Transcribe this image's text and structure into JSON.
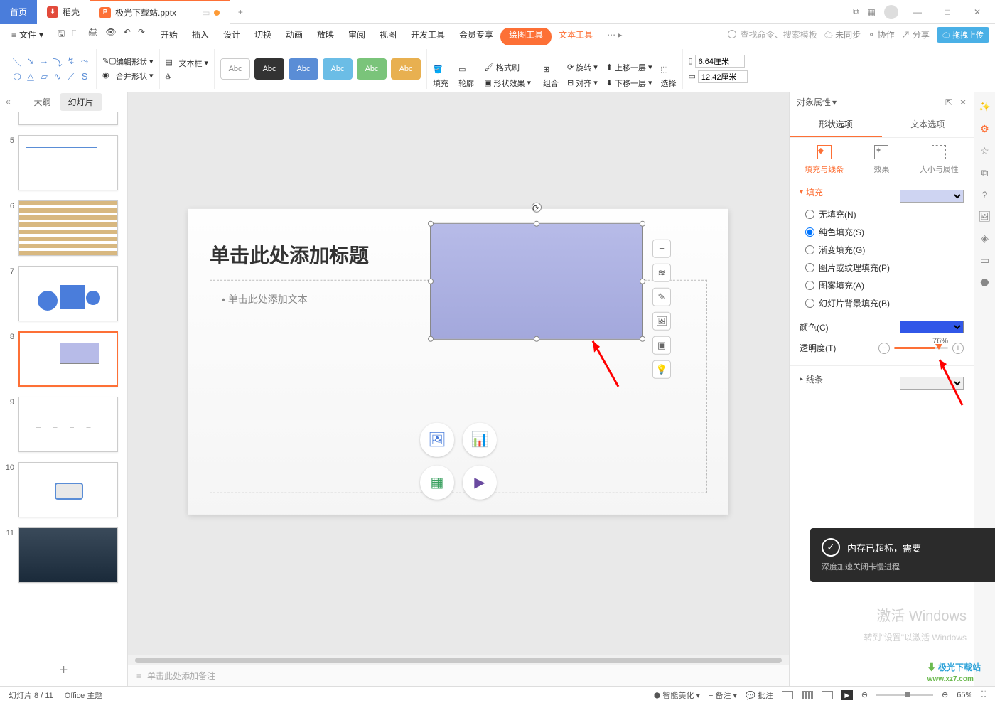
{
  "titlebar": {
    "home": "首页",
    "docer": "稻壳",
    "filename": "极光下载站.pptx"
  },
  "menubar": {
    "file": "文件",
    "menus": [
      "开始",
      "插入",
      "设计",
      "切换",
      "动画",
      "放映",
      "审阅",
      "视图",
      "开发工具",
      "会员专享"
    ],
    "contextual1": "绘图工具",
    "contextual2": "文本工具",
    "search_ph": "查找命令、搜索模板",
    "unsync": "未同步",
    "coop": "协作",
    "share": "分享",
    "cloud": "拖拽上传"
  },
  "ribbon": {
    "edit_shape": "编辑形状",
    "merge_shape": "合并形状",
    "textbox": "文本框",
    "swatch_label": "Abc",
    "fill": "填充",
    "outline": "轮廓",
    "format_painter": "格式刷",
    "shape_effect": "形状效果",
    "group": "组合",
    "rotate": "旋转",
    "align": "对齐",
    "bring_forward": "上移一层",
    "send_backward": "下移一层",
    "select": "选择",
    "height": "6.64厘米",
    "width": "12.42厘米"
  },
  "left": {
    "tab_outline": "大纲",
    "tab_slides": "幻灯片",
    "nums": [
      "5",
      "6",
      "7",
      "8",
      "9",
      "10",
      "11"
    ]
  },
  "slide": {
    "title_ph": "单击此处添加标题",
    "body_ph": "单击此处添加文本",
    "notes_ph": "单击此处添加备注"
  },
  "right": {
    "header": "对象属性",
    "tab_shape": "形状选项",
    "tab_text": "文本选项",
    "sub_fill": "填充与线条",
    "sub_effect": "效果",
    "sub_size": "大小与属性",
    "section_fill": "填充",
    "radios": {
      "none": "无填充(N)",
      "solid": "纯色填充(S)",
      "gradient": "渐变填充(G)",
      "picture": "图片或纹理填充(P)",
      "pattern": "图案填充(A)",
      "slidebg": "幻灯片背景填充(B)"
    },
    "color": "颜色(C)",
    "transparency": "透明度(T)",
    "transparency_val": "76%",
    "section_line": "线条"
  },
  "status": {
    "slide_pos": "幻灯片 8 / 11",
    "theme": "Office 主题",
    "beautify": "智能美化",
    "notes": "备注",
    "comments": "批注",
    "zoom": "65%"
  },
  "notif": {
    "title": "内存已超标，需要",
    "sub": "深度加速关闭卡慢进程"
  },
  "wm": {
    "l1": "激活 Windows",
    "l2": "转到\"设置\"以激活 Windows",
    "logo1": "极光下载站",
    "logo2": "www.xz7.com"
  }
}
